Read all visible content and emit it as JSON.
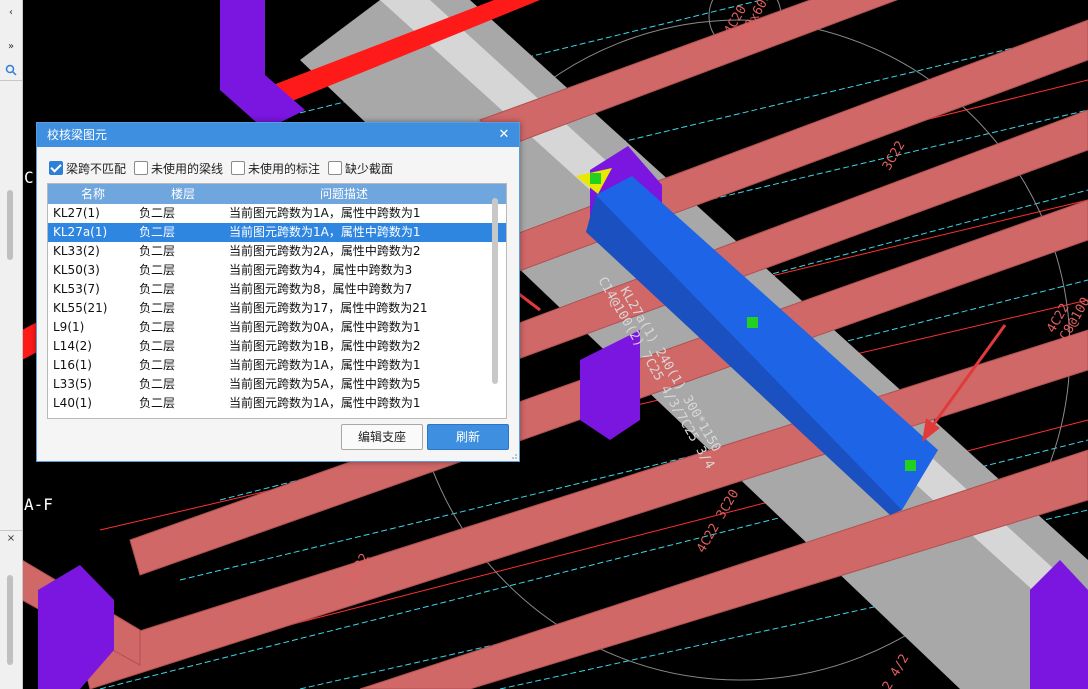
{
  "cad": {
    "labels": {
      "column_tag": "4C20\n300x600",
      "beam_3c22_top": "3C22",
      "beam_4c22_right": "4C22\nC8@100",
      "beam_text_main": "KL27a(1) 240(1) 300*1150",
      "beam_text_sub": "C14@100(2) 7C25 4/3/7C25 3/4",
      "beam_3c22_bottom": "3C22",
      "beam_4c22_3c20": "4C22 3C20",
      "bottom_right": "2 4/2",
      "axis_left_top": "C",
      "axis_left_bottom": "A-F"
    },
    "colors": {
      "beam_red": "#d06868",
      "beam_selected": "#1e64e6",
      "column": "#7a16e0",
      "slab": "#a8a8a8",
      "slab_edge": "#d6d6d6",
      "red_bar": "#ff1a1a",
      "grid_cyan": "#3fd6e6",
      "marker": "#22d022",
      "arrow": "#e23a3a"
    }
  },
  "dialog": {
    "title": "校核梁图元",
    "close_icon": "close-icon",
    "filters": [
      {
        "label": "梁跨不匹配",
        "checked": true
      },
      {
        "label": "未使用的梁线",
        "checked": false
      },
      {
        "label": "未使用的标注",
        "checked": false
      },
      {
        "label": "缺少截面",
        "checked": false
      }
    ],
    "columns": [
      "名称",
      "楼层",
      "问题描述"
    ],
    "rows": [
      {
        "name": "KL27(1)",
        "floor": "负二层",
        "desc": "当前图元跨数为1A，属性中跨数为1",
        "selected": false
      },
      {
        "name": "KL27a(1)",
        "floor": "负二层",
        "desc": "当前图元跨数为1A，属性中跨数为1",
        "selected": true
      },
      {
        "name": "KL33(2)",
        "floor": "负二层",
        "desc": "当前图元跨数为2A，属性中跨数为2",
        "selected": false
      },
      {
        "name": "KL50(3)",
        "floor": "负二层",
        "desc": "当前图元跨数为4，属性中跨数为3",
        "selected": false
      },
      {
        "name": "KL53(7)",
        "floor": "负二层",
        "desc": "当前图元跨数为8，属性中跨数为7",
        "selected": false
      },
      {
        "name": "KL55(21)",
        "floor": "负二层",
        "desc": "当前图元跨数为17，属性中跨数为21",
        "selected": false
      },
      {
        "name": "L9(1)",
        "floor": "负二层",
        "desc": "当前图元跨数为0A，属性中跨数为1",
        "selected": false
      },
      {
        "name": "L14(2)",
        "floor": "负二层",
        "desc": "当前图元跨数为1B，属性中跨数为2",
        "selected": false
      },
      {
        "name": "L16(1)",
        "floor": "负二层",
        "desc": "当前图元跨数为1A，属性中跨数为1",
        "selected": false
      },
      {
        "name": "L33(5)",
        "floor": "负二层",
        "desc": "当前图元跨数为5A，属性中跨数为5",
        "selected": false
      },
      {
        "name": "L40(1)",
        "floor": "负二层",
        "desc": "当前图元跨数为1A，属性中跨数为1",
        "selected": false
      }
    ],
    "btn_edit": "编辑支座",
    "btn_refresh": "刷新"
  },
  "sidebar": {
    "expand_icon": "double-chevron-right-icon",
    "search_icon": "search-icon",
    "close_icon": "close-icon"
  }
}
